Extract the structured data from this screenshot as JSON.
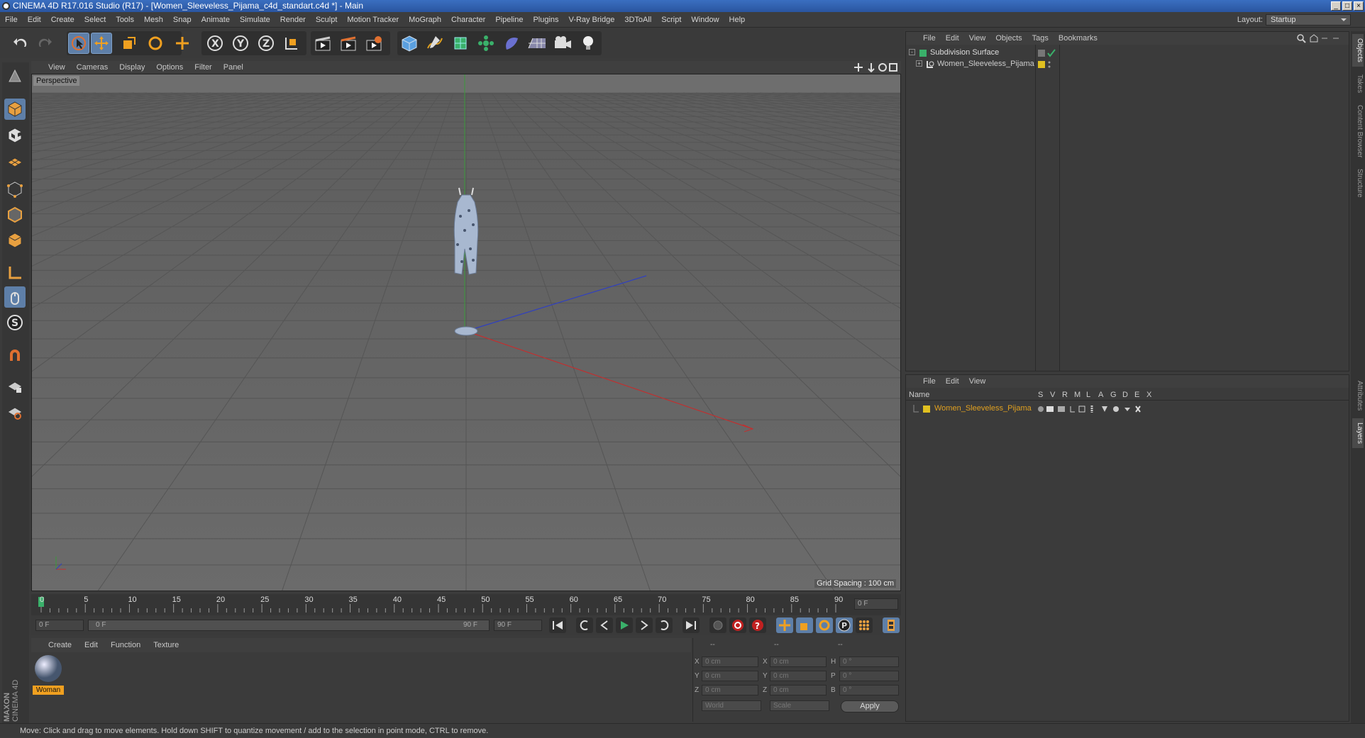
{
  "window": {
    "title": "CINEMA 4D R17.016 Studio (R17) - [Women_Sleeveless_Pijama_c4d_standart.c4d *] - Main"
  },
  "menu": [
    "File",
    "Edit",
    "Create",
    "Select",
    "Tools",
    "Mesh",
    "Snap",
    "Animate",
    "Simulate",
    "Render",
    "Sculpt",
    "Motion Tracker",
    "MoGraph",
    "Character",
    "Pipeline",
    "Plugins",
    "V-Ray Bridge",
    "3DToAll",
    "Script",
    "Window",
    "Help"
  ],
  "layout": {
    "label": "Layout:",
    "value": "Startup"
  },
  "viewport": {
    "menu": [
      "View",
      "Cameras",
      "Display",
      "Options",
      "Filter",
      "Panel"
    ],
    "label": "Perspective",
    "grid_spacing": "Grid Spacing : 100 cm"
  },
  "timeline": {
    "ticks": [
      "0",
      "5",
      "10",
      "15",
      "20",
      "25",
      "30",
      "35",
      "40",
      "45",
      "50",
      "55",
      "60",
      "65",
      "70",
      "75",
      "80",
      "85",
      "90"
    ],
    "frame_field": "0 F",
    "start_field": "0 F",
    "range_start": "0 F",
    "range_end": "90 F",
    "end_field": "90 F"
  },
  "material_panel": {
    "menu": [
      "Create",
      "Edit",
      "Function",
      "Texture"
    ],
    "material_name": "Woman"
  },
  "coords": {
    "headers": [
      "--",
      "--",
      "--"
    ],
    "rows": [
      {
        "a": "X",
        "av": "0 cm",
        "b": "X",
        "bv": "0 cm",
        "c": "H",
        "cv": "0 °"
      },
      {
        "a": "Y",
        "av": "0 cm",
        "b": "Y",
        "bv": "0 cm",
        "c": "P",
        "cv": "0 °"
      },
      {
        "a": "Z",
        "av": "0 cm",
        "b": "Z",
        "bv": "0 cm",
        "c": "B",
        "cv": "0 °"
      }
    ],
    "world": "World",
    "scale": "Scale",
    "apply": "Apply"
  },
  "status": "Move: Click and drag to move elements. Hold down SHIFT to quantize movement / add to the selection in point mode, CTRL to remove.",
  "object_manager": {
    "menu": [
      "File",
      "Edit",
      "View",
      "Objects",
      "Tags",
      "Bookmarks"
    ],
    "items": [
      "Subdivision Surface",
      "Women_Sleeveless_Pijama"
    ]
  },
  "layer_manager": {
    "menu": [
      "File",
      "Edit",
      "View"
    ],
    "columns_name": "Name",
    "columns": [
      "S",
      "V",
      "R",
      "M",
      "L",
      "A",
      "G",
      "D",
      "E",
      "X"
    ],
    "layer_name": "Women_Sleeveless_Pijama"
  },
  "side_tabs": [
    "Objects",
    "Takes",
    "Content Browser",
    "Structure",
    "Attributes",
    "Layers"
  ],
  "brand": [
    "MAXON",
    "CINEMA 4D"
  ],
  "colors": {
    "accent": "#5e7fa8",
    "layer": "#e0c020",
    "axis_x": "#c03030",
    "axis_y": "#30a030",
    "axis_z": "#3040c0"
  }
}
